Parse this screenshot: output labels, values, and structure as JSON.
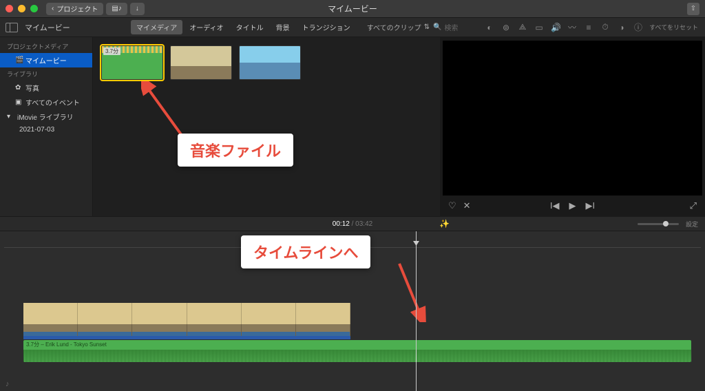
{
  "titlebar": {
    "back": "プロジェクト",
    "title": "マイムービー"
  },
  "toolbar": {
    "crumb": "マイムービー",
    "tabs": [
      "マイメディア",
      "オーディオ",
      "タイトル",
      "背景",
      "トランジション"
    ],
    "active_tab": 0,
    "filter": "すべてのクリップ",
    "search_placeholder": "検索",
    "reset": "すべてをリセット"
  },
  "sidebar": {
    "section1": "プロジェクトメディア",
    "item_movie": "マイムービー",
    "section2": "ライブラリ",
    "item_photos": "写真",
    "item_events": "すべてのイベント",
    "item_lib": "iMovie ライブラリ",
    "item_date": "2021-07-03"
  },
  "browser": {
    "clips": [
      {
        "kind": "audio",
        "dur": "3.7分"
      },
      {
        "kind": "vid1"
      },
      {
        "kind": "vid2"
      }
    ]
  },
  "annotations": {
    "callout1": "音楽ファイル",
    "callout2": "タイムラインへ"
  },
  "time": {
    "current": "00:12",
    "total": "03:42",
    "settings": "設定"
  },
  "timeline": {
    "audio_label": "3.7分 – Erik Lund - Tokyo Sunset"
  }
}
